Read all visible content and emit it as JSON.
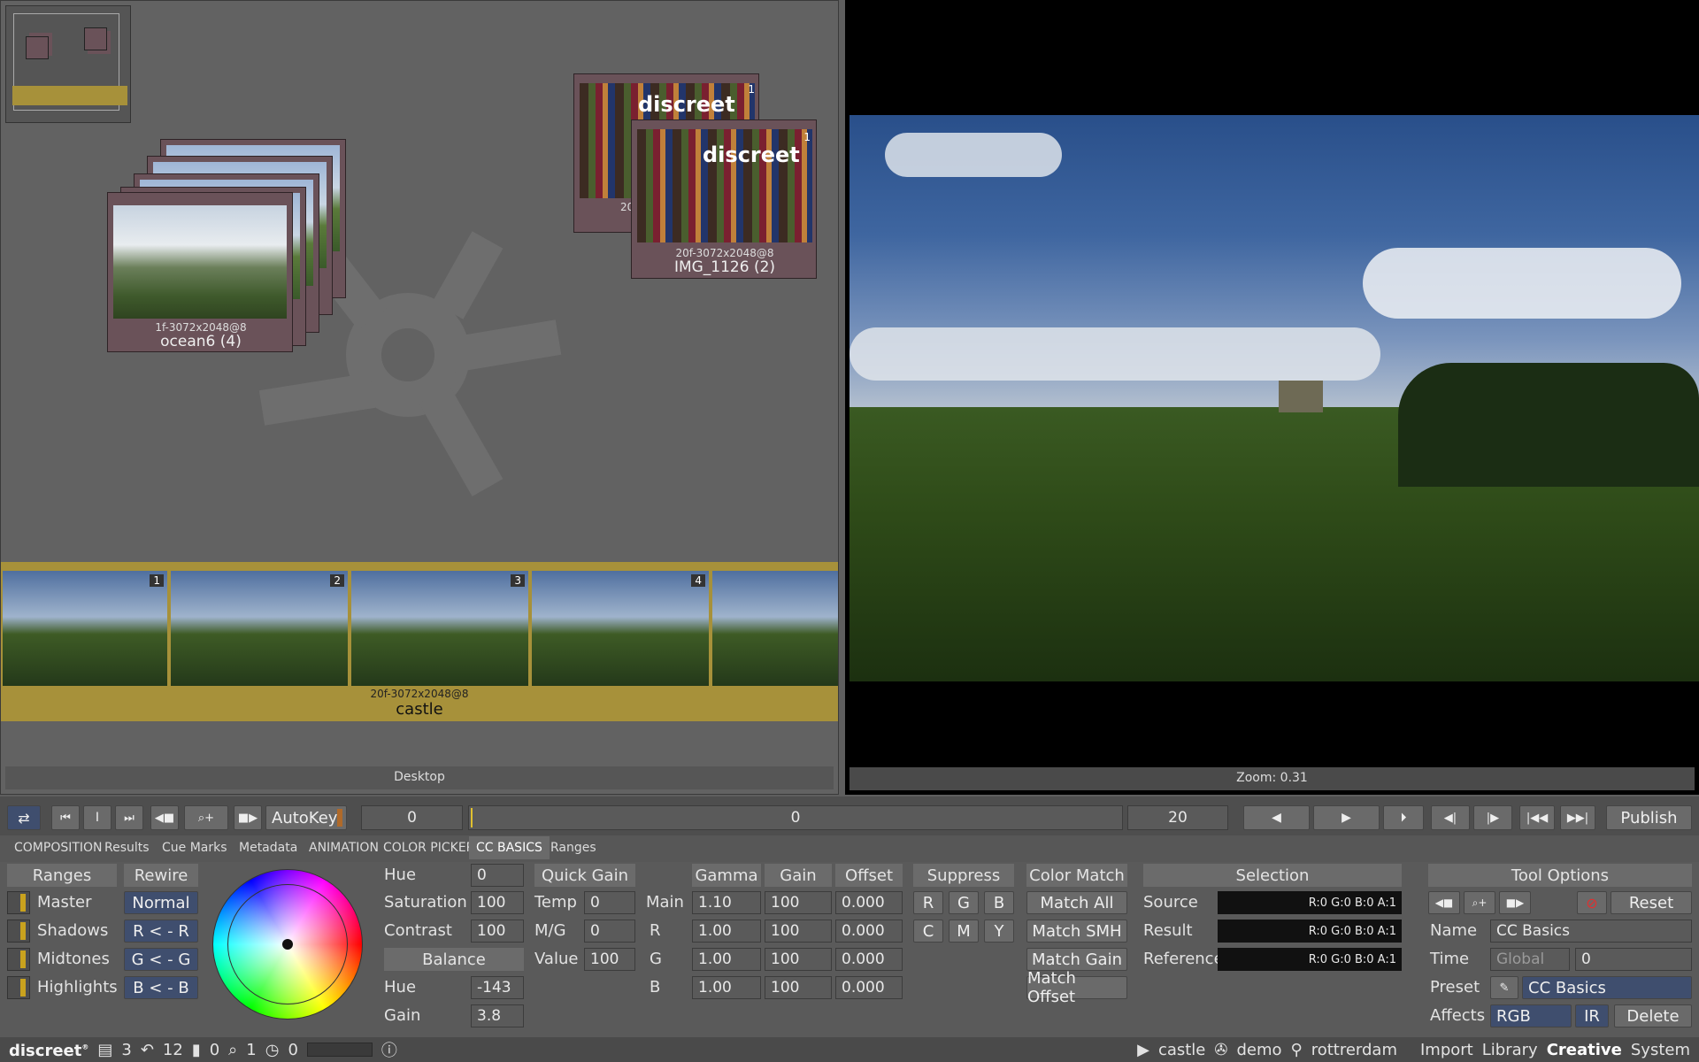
{
  "desktop": {
    "label": "Desktop",
    "clips": [
      {
        "res": "1f-3072x2048@8",
        "name": "ocean6 (4)"
      },
      {
        "res": "20f-3072x2048@8",
        "name": "IMG_1126 (2)",
        "badge": "1",
        "partial_res": "20"
      }
    ],
    "reel": {
      "res": "20f-3072x2048@8",
      "name": "castle",
      "frames": [
        "1",
        "2",
        "3",
        "4"
      ]
    }
  },
  "viewer": {
    "zoom": "Zoom: 0.31"
  },
  "transport": {
    "autokey": "AutoKey",
    "start": "0",
    "current": "0",
    "end": "20",
    "publish": "Publish"
  },
  "tabs": [
    "COMPOSITION",
    "Results",
    "Cue Marks",
    "Metadata",
    "ANIMATION",
    "COLOR PICKER",
    "CC BASICS",
    "Ranges"
  ],
  "ranges": {
    "header": "Ranges",
    "rewire_header": "Rewire",
    "rows": [
      {
        "label": "Master",
        "rewire": "Normal"
      },
      {
        "label": "Shadows",
        "rewire": "R < - R"
      },
      {
        "label": "Midtones",
        "rewire": "G < - G"
      },
      {
        "label": "Highlights",
        "rewire": "B < - B"
      }
    ]
  },
  "hsc": {
    "hue_label": "Hue",
    "hue": "0",
    "sat_label": "Saturation",
    "sat": "100",
    "con_label": "Contrast",
    "con": "100",
    "balance": "Balance",
    "bhue_label": "Hue",
    "bhue": "-143",
    "gain_label": "Gain",
    "gain": "3.8"
  },
  "quick_gain": {
    "header": "Quick Gain",
    "rows": [
      {
        "label": "Temp",
        "value": "0"
      },
      {
        "label": "M/G",
        "value": "0"
      },
      {
        "label": "Value",
        "value": "100"
      }
    ]
  },
  "ggo": {
    "headers": [
      "Gamma",
      "Gain",
      "Offset"
    ],
    "rows": [
      {
        "label": "Main",
        "gamma": "1.10",
        "gain": "100",
        "offset": "0.000"
      },
      {
        "label": "R",
        "gamma": "1.00",
        "gain": "100",
        "offset": "0.000"
      },
      {
        "label": "G",
        "gamma": "1.00",
        "gain": "100",
        "offset": "0.000"
      },
      {
        "label": "B",
        "gamma": "1.00",
        "gain": "100",
        "offset": "0.000"
      }
    ]
  },
  "suppress": {
    "header": "Suppress",
    "row1": [
      "R",
      "G",
      "B"
    ],
    "row2": [
      "C",
      "M",
      "Y"
    ]
  },
  "color_match": {
    "header": "Color Match",
    "buttons": [
      "Match All",
      "Match SMH",
      "Match Gain",
      "Match Offset"
    ]
  },
  "selection": {
    "header": "Selection",
    "rows": [
      {
        "label": "Source",
        "value": "R:0 G:0 B:0 A:1"
      },
      {
        "label": "Result",
        "value": "R:0 G:0 B:0 A:1"
      },
      {
        "label": "Reference",
        "value": "R:0 G:0 B:0 A:1"
      }
    ]
  },
  "tool_options": {
    "header": "Tool Options",
    "reset": "Reset",
    "name_label": "Name",
    "name": "CC Basics",
    "time_label": "Time",
    "time_mode": "Global",
    "time_value": "0",
    "preset_label": "Preset",
    "preset": "CC Basics",
    "affects_label": "Affects",
    "affects": "RGB",
    "ir": "IR",
    "delete": "Delete"
  },
  "status": {
    "brand": "discreet",
    "trademark": "®",
    "items": [
      "3",
      "12",
      "0",
      "1",
      "0"
    ],
    "project": "castle",
    "user": "demo",
    "host": "rottrerdam",
    "menu": [
      "Import",
      "Library",
      "Creative",
      "System"
    ]
  },
  "colors": {
    "accent_gold": "#a7913a",
    "card_mauve": "#6a5259",
    "button_blue": "#3f4e6e"
  }
}
